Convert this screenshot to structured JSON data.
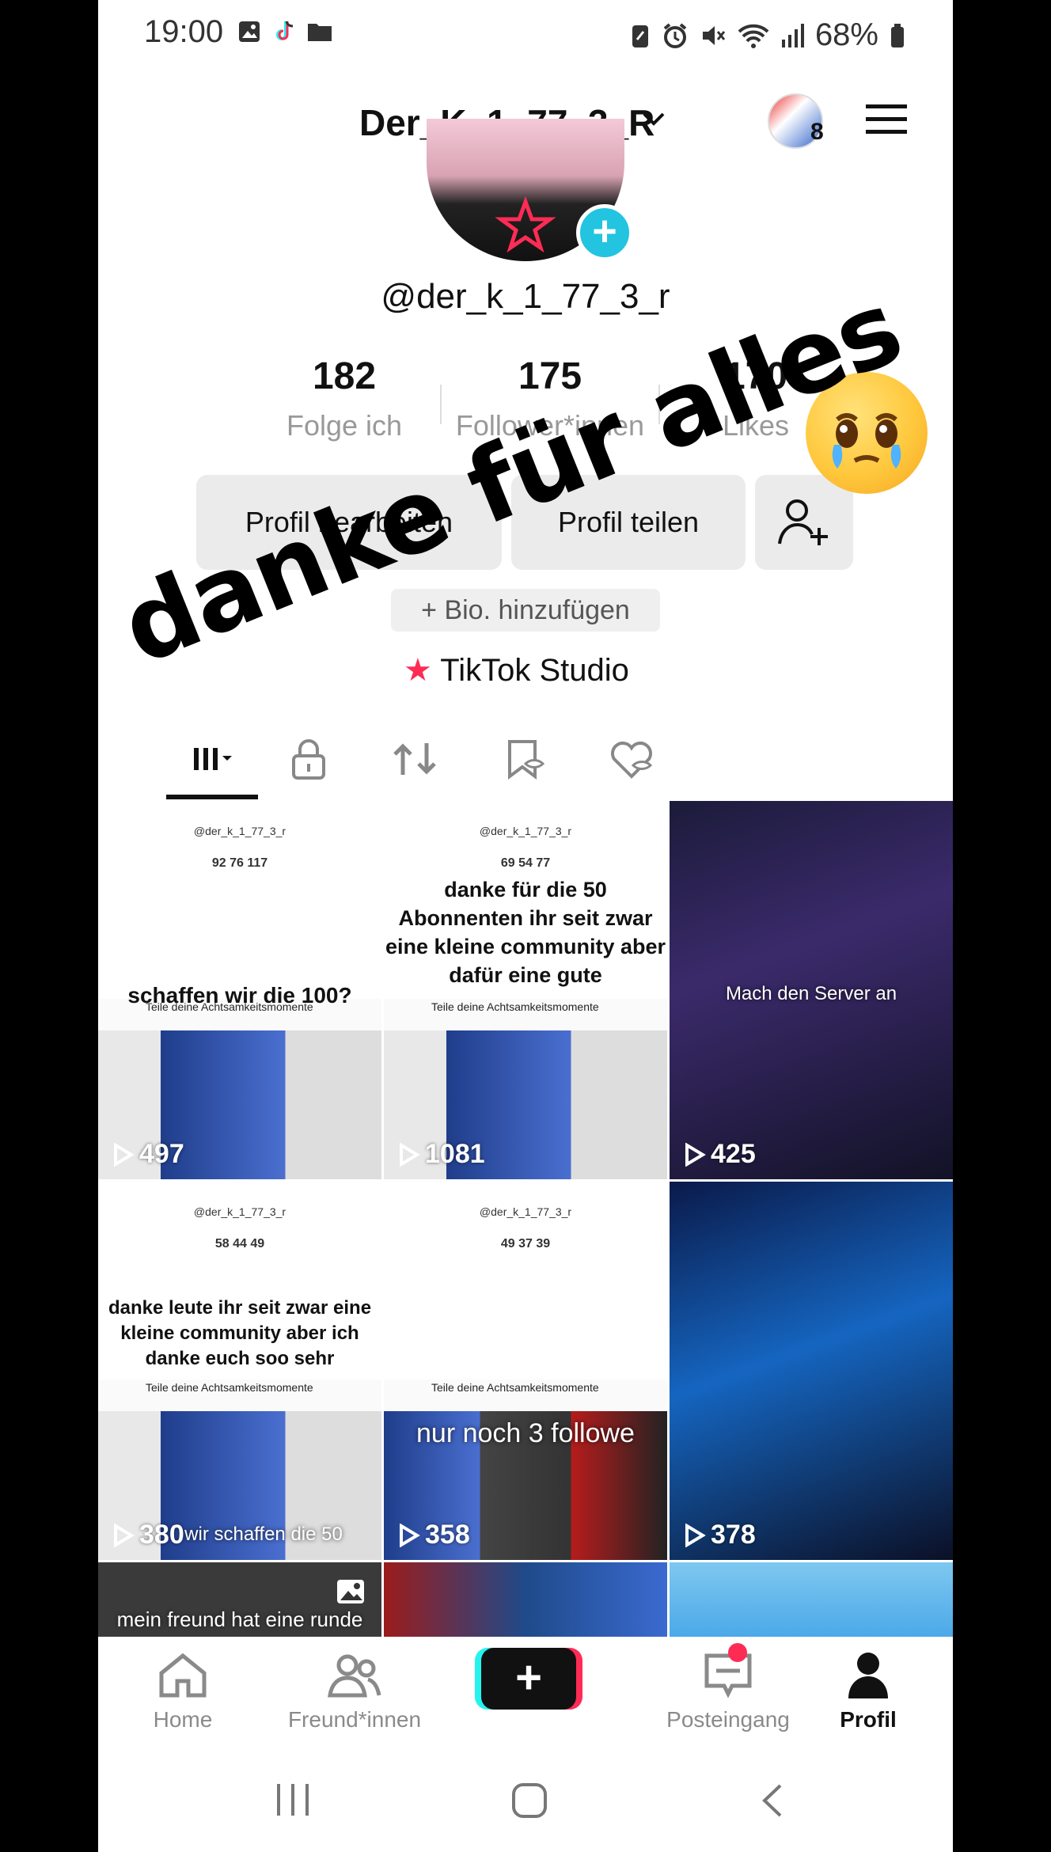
{
  "status_bar": {
    "time": "19:00",
    "battery": "68%"
  },
  "header": {
    "username": "Der_K_1_77_3_R",
    "notification_count": "8"
  },
  "profile": {
    "handle": "@der_k_1_77_3_r",
    "stats": [
      {
        "value": "182",
        "label": "Folge ich"
      },
      {
        "value": "175",
        "label": "Follower*innen"
      },
      {
        "value": "170",
        "label": "Likes"
      }
    ],
    "edit_button": "Profil bearbeiten",
    "share_button": "Profil teilen",
    "add_bio": "+ Bio. hinzufügen",
    "studio": "TikTok Studio"
  },
  "overlay": {
    "text": "danke für alles"
  },
  "grid": [
    {
      "views": "497",
      "caption": "schaffen wir die 100?",
      "handle": "@der_k_1_77_3_r",
      "stats": "92  76  117",
      "banner": "Teile deine Achtsamkeitsmomente"
    },
    {
      "views": "1081",
      "caption": "danke für die 50 Abonnenten ihr seit zwar eine kleine community aber dafür eine gute",
      "handle": "@der_k_1_77_3_r",
      "stats": "69  54  77",
      "banner": "Teile deine Achtsamkeitsmomente"
    },
    {
      "views": "425",
      "caption": "Mach den Server an"
    },
    {
      "views": "380",
      "caption": "danke leute ihr seit zwar eine kleine community aber ich danke euch soo sehr",
      "handle": "@der_k_1_77_3_r",
      "stats": "58  44  49",
      "banner": "Teile deine Achtsamkeitsmomente",
      "bottom_caption": "wir schaffen die 50"
    },
    {
      "views": "358",
      "caption": "nur noch 3 followe",
      "handle": "@der_k_1_77_3_r",
      "stats": "49  37  39",
      "banner": "Teile deine Achtsamkeitsmomente"
    },
    {
      "views": "378",
      "caption": ""
    },
    {
      "caption": "mein freund hat eine runde"
    },
    {
      "caption": ""
    },
    {
      "caption": ""
    }
  ],
  "bottom_nav": [
    {
      "label": "Home",
      "icon": "home-icon"
    },
    {
      "label": "Freund*innen",
      "icon": "friends-icon"
    },
    {
      "label": "",
      "icon": "plus-icon"
    },
    {
      "label": "Posteingang",
      "icon": "inbox-icon"
    },
    {
      "label": "Profil",
      "icon": "profile-icon"
    }
  ],
  "colors": {
    "accent_cyan": "#25f4ee",
    "accent_pink": "#fe2c55",
    "plus_blue": "#22c4e0"
  }
}
